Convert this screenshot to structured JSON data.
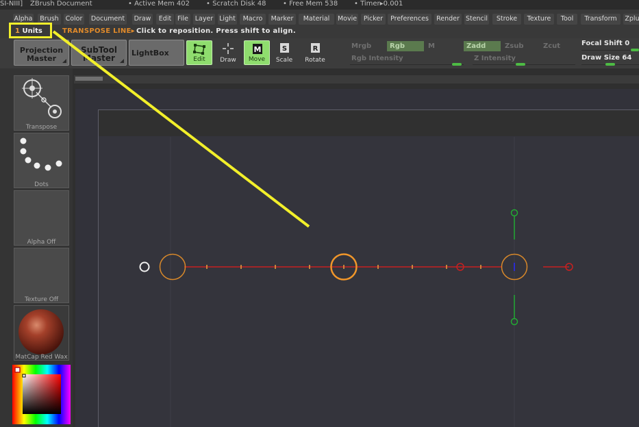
{
  "title_bar": {
    "app": "SI-NIII]",
    "document": "ZBrush Document",
    "active_mem": "• Active Mem 402",
    "scratch_disk": "• Scratch Disk 48",
    "free_mem": "• Free Mem 538",
    "timer": "• Timer▸0.001"
  },
  "menu": [
    "Alpha",
    "Brush",
    "Color",
    "Document",
    "Draw",
    "Edit",
    "File",
    "Layer",
    "Light",
    "Macro",
    "Marker",
    "Material",
    "Movie",
    "Picker",
    "Preferences",
    "Render",
    "Stencil",
    "Stroke",
    "Texture",
    "Tool",
    "Transform",
    "Zplu"
  ],
  "info": {
    "units_number": "1",
    "units_label": "Units",
    "mode_label": "TRANSPOSE LINE▸",
    "message": "Click to reposition. Press shift to align."
  },
  "shelf": {
    "projection_master": [
      "Projection",
      "Master"
    ],
    "subtool_master": [
      "SubTool",
      "Master"
    ],
    "lightbox": "LightBox",
    "tools": [
      {
        "label": "Edit",
        "active": true
      },
      {
        "label": "Draw",
        "active": false
      },
      {
        "label": "Move",
        "active": true
      },
      {
        "label": "Scale",
        "active": false
      },
      {
        "label": "Rotate",
        "active": false
      }
    ],
    "channels_row1": [
      {
        "label": "Mrgb",
        "on": false
      },
      {
        "label": "Rgb",
        "on": true
      },
      {
        "label": "M",
        "on": false
      },
      {
        "label": "Zadd",
        "on": true
      },
      {
        "label": "Zsub",
        "on": false
      },
      {
        "label": "Zcut",
        "on": false
      }
    ],
    "rgb_intensity": "Rgb Intensity",
    "z_intensity": "Z Intensity",
    "focal_shift": "Focal Shift 0",
    "draw_size": "Draw Size 64"
  },
  "left_tray": [
    {
      "label": "Transpose"
    },
    {
      "label": "Dots"
    },
    {
      "label": "Alpha Off"
    },
    {
      "label": "Texture Off"
    },
    {
      "label": "MatCap Red Wax"
    }
  ],
  "colors": {
    "accent_green": "#8fdd6e",
    "highlight_yellow": "#f2ef2a",
    "transpose_orange": "#e08a2a",
    "transpose_red": "#c82020",
    "axis_green": "#22aa33"
  }
}
